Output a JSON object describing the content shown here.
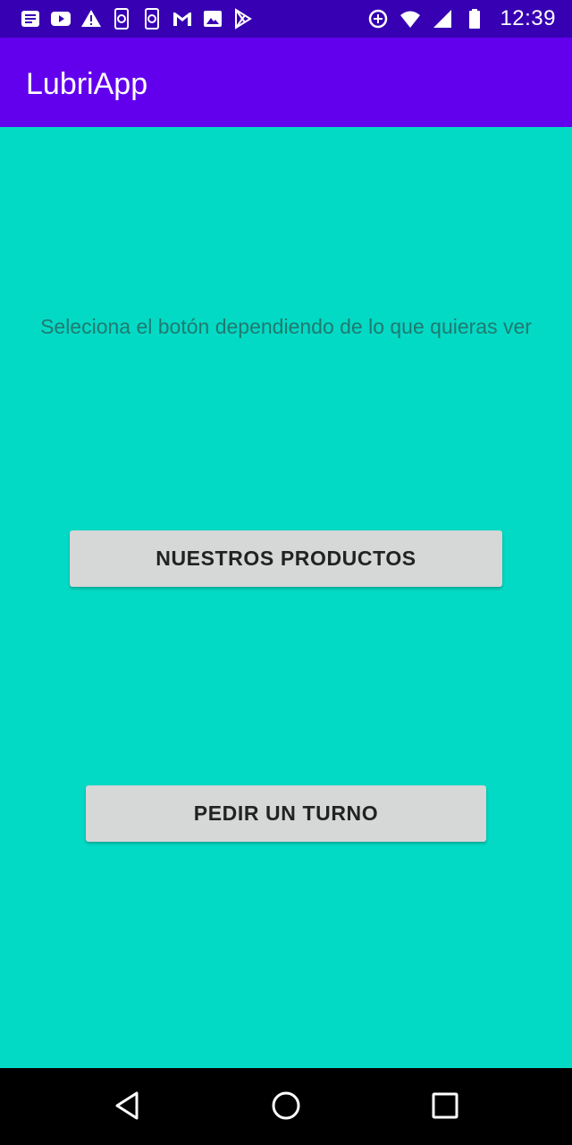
{
  "status_bar": {
    "time": "12:39",
    "left_icons": [
      "notes-icon",
      "youtube-icon",
      "warning-icon",
      "phone-sync-icon",
      "phone-sync-icon-2",
      "gmail-icon",
      "image-icon",
      "play-store-icon"
    ],
    "right_icons": [
      "data-saver-icon",
      "wifi-icon",
      "cell-signal-icon",
      "battery-icon"
    ]
  },
  "app_bar": {
    "title": "LubriApp"
  },
  "main": {
    "prompt": "Seleciona el botón dependiendo de lo que quieras ver",
    "products_button": "NUESTROS PRODUCTOS",
    "turno_button": "PEDIR UN TURNO"
  },
  "colors": {
    "status_bar": "#3700b3",
    "app_bar": "#6200ee",
    "background": "#03dac5",
    "button": "#d6d7d7"
  }
}
